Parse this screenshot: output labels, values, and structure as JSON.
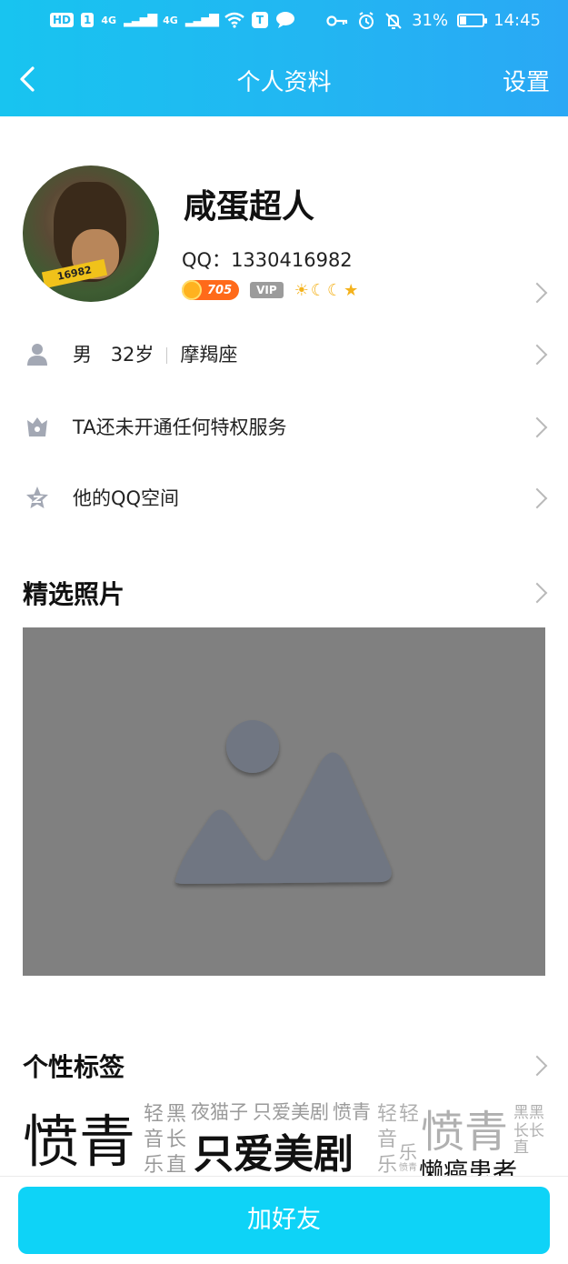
{
  "status_bar": {
    "left_chip1": "HD",
    "left_chip2": "1",
    "signal1": "4G",
    "signal2": "4G",
    "battery_percent": "31%",
    "battery_level": 0.31,
    "time": "14:45"
  },
  "nav": {
    "title": "个人资料",
    "settings": "设置"
  },
  "profile": {
    "avatar_tag": "16982",
    "nickname": "咸蛋超人",
    "qq_label": "QQ：",
    "qq_number": "1330416982",
    "level_value": "705",
    "vip_label": "VIP",
    "level_icons": [
      "☀",
      "☾",
      "☾",
      "★"
    ]
  },
  "info_rows": {
    "gender": "男",
    "age": "32岁",
    "sign": "摩羯座",
    "privilege": "TA还未开通任何特权服务",
    "qzone": "他的QQ空间"
  },
  "sections": {
    "photos_title": "精选照片",
    "tags_title": "个性标签"
  },
  "tag_cloud": [
    "愤青",
    "轻",
    "黑",
    "夜猫子",
    "只爱美剧",
    "愤青",
    "轻",
    "轻",
    "愤青",
    "黑",
    "黑",
    "音",
    "长",
    "只爱美剧",
    "音",
    "长",
    "长",
    "乐",
    "直",
    "乐",
    "乐",
    "直",
    "懒癌患者",
    "愤青"
  ],
  "bottom": {
    "add_friend": "加好友"
  }
}
